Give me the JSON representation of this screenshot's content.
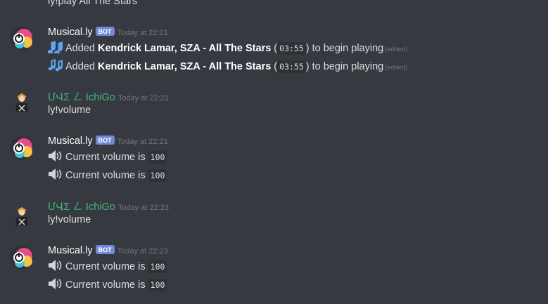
{
  "top_fragment": "ly!play All The Stars",
  "messages": [
    {
      "author": "Musical.ly",
      "bot_label": "BOT",
      "time": "Today at 22:21",
      "lines": [
        {
          "pre": "Added ",
          "bold": "Kendrick Lamar, SZA - All The Stars",
          "mid": " (",
          "code": "03:55",
          "post": ") to begin playing",
          "edited": "(edited)"
        },
        {
          "pre": "Added ",
          "bold": "Kendrick Lamar, SZA - All The Stars",
          "mid": " (",
          "code": "03:55",
          "post": ") to begin playing",
          "edited": "(edited)"
        }
      ]
    },
    {
      "author": "ՄՎΣ ㄥ IchiGo",
      "time": "Today at 22:21",
      "text": "ly!volume"
    },
    {
      "author": "Musical.ly",
      "bot_label": "BOT",
      "time": "Today at 22:21",
      "lines": [
        {
          "text": "Current volume is ",
          "code": "100"
        },
        {
          "text": "Current volume is ",
          "code": "100"
        }
      ]
    },
    {
      "author": "ՄՎΣ ㄥ IchiGo",
      "time": "Today at 22:23",
      "text": "ly!volume"
    },
    {
      "author": "Musical.ly",
      "bot_label": "BOT",
      "time": "Today at 22:23",
      "lines": [
        {
          "text": "Current volume is ",
          "code": "100"
        },
        {
          "text": "Current volume is ",
          "code": "100"
        }
      ]
    }
  ],
  "colors": {
    "background": "#36393f",
    "bot_badge": "#7289da",
    "user_name": "#43b581",
    "timestamp": "#72767d",
    "note_icon": "#5ea7f0"
  }
}
